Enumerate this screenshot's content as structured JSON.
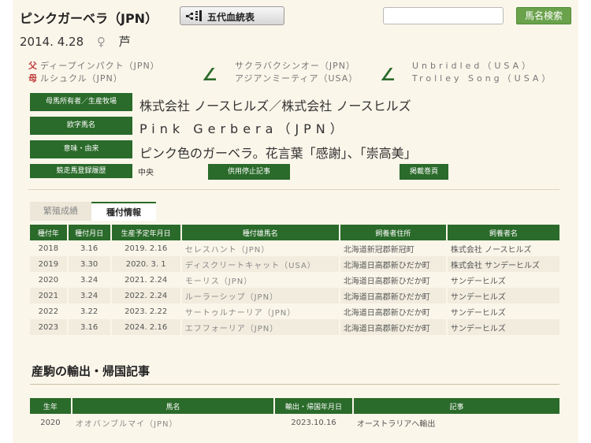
{
  "header": {
    "horse_name": "ピンクガーベラ（JPN）",
    "pedigree_button": "五代血統表",
    "search_placeholder": "",
    "search_button": "馬名検索"
  },
  "birth": {
    "date": "2014. 4.28",
    "sex": "♀",
    "coat": "芦"
  },
  "parents": {
    "sire_mark": "父",
    "sire": "ディープインパクト（JPN）",
    "dam_mark": "母",
    "dam": "ルシュクル（JPN）",
    "sire_sire": "サクラバクシンオー（JPN）",
    "sire_dam": "アジアンミーティア（USA）",
    "dam_sire": "Unbridled（USA）",
    "dam_dam": "Trolley Song（USA）"
  },
  "info": {
    "owner_label": "母馬所有者／生産牧場",
    "owner_value": "株式会社 ノースヒルズ／株式会社 ノースヒルズ",
    "roman_label": "欧字馬名",
    "roman_value": "Pink Gerbera（JPN）",
    "meaning_label": "意味・由来",
    "meaning_value": "ピンク色のガーベラ。花言葉「感謝」、「崇高美」",
    "history_label": "競走馬登録履歴",
    "history_value": "中央",
    "retire_button": "供用停止記事",
    "page_button": "掲載巻頁"
  },
  "tabs": [
    "繁殖成績",
    "種付情報"
  ],
  "stud_table": {
    "headers": [
      "種付年",
      "種付月日",
      "生産予定年月日",
      "種付雄馬名",
      "飼養者住所",
      "飼養者名"
    ],
    "rows": [
      [
        "2018",
        "3.16",
        "2019. 2.16",
        "セレスハント（JPN）",
        "北海道新冠郡新冠町",
        "株式会社 ノースヒルズ"
      ],
      [
        "2019",
        "3.30",
        "2020. 3. 1",
        "ディスクリートキャット（USA）",
        "北海道日高郡新ひだか町",
        "株式会社 サンデーヒルズ"
      ],
      [
        "2020",
        "3.24",
        "2021. 2.24",
        "モーリス（JPN）",
        "北海道日高郡新ひだか町",
        "サンデーヒルズ"
      ],
      [
        "2021",
        "3.24",
        "2022. 2.24",
        "ルーラーシップ（JPN）",
        "北海道日高郡新ひだか町",
        "サンデーヒルズ"
      ],
      [
        "2022",
        "3.22",
        "2023. 2.22",
        "サートゥルナーリア（JPN）",
        "北海道日高郡新ひだか町",
        "サンデーヒルズ"
      ],
      [
        "2023",
        "3.16",
        "2024. 2.16",
        "エフフォーリア（JPN）",
        "北海道日高郡新ひだか町",
        "サンデーヒルズ"
      ]
    ]
  },
  "export_section": {
    "title": "産駒の輸出・帰国記事",
    "headers": [
      "生年",
      "馬名",
      "輸出・帰国年月日",
      "記事"
    ],
    "rows": [
      [
        "2020",
        "オオバンブルマイ（JPN）",
        "2023.10.16",
        "オーストラリアへ輸出"
      ]
    ]
  },
  "colors": {
    "accent": "#2a6a2a",
    "search_button": "#6aa24b",
    "sex_mark": "#c03c3c"
  }
}
